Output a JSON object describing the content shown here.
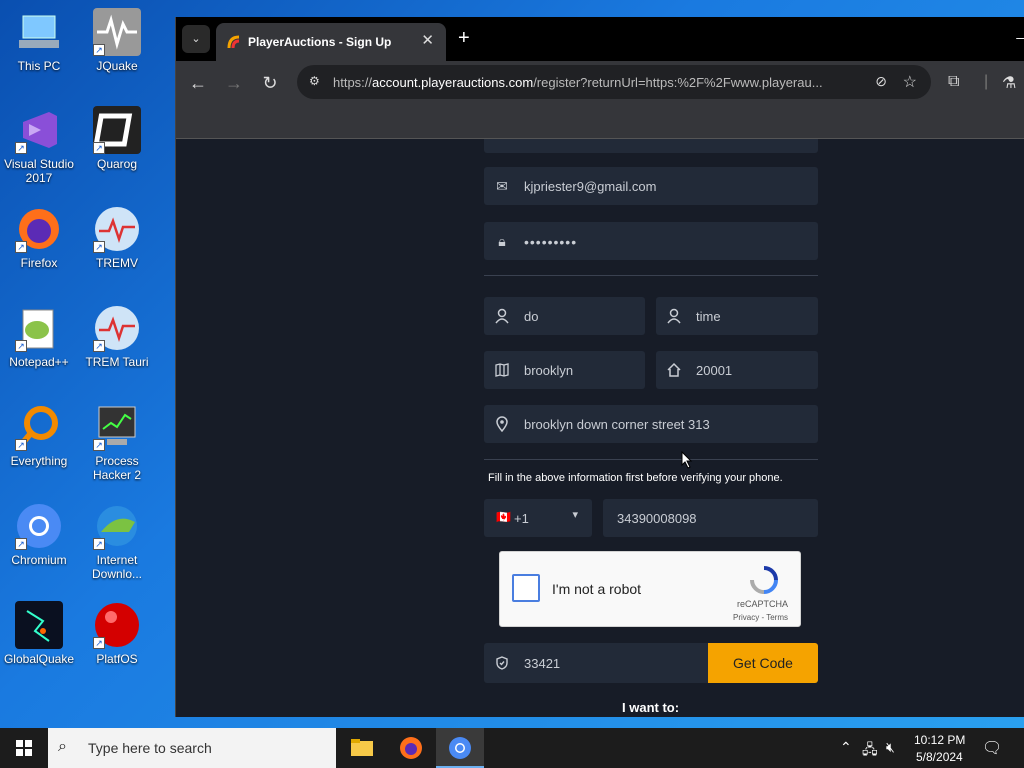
{
  "desktop": {
    "icons": [
      {
        "label": "This PC",
        "icon": "computer-icon"
      },
      {
        "label": "JQuake",
        "icon": "seismograph-icon"
      },
      {
        "label": "Visual Studio 2017",
        "icon": "visual-studio-icon"
      },
      {
        "label": "Quarog",
        "icon": "quarog-icon"
      },
      {
        "label": "Firefox",
        "icon": "firefox-icon"
      },
      {
        "label": "TREMV",
        "icon": "trem-icon"
      },
      {
        "label": "Notepad++",
        "icon": "notepadpp-icon"
      },
      {
        "label": "TREM Tauri",
        "icon": "trem-tauri-icon"
      },
      {
        "label": "Everything",
        "icon": "search-magnifier-icon"
      },
      {
        "label": "Process Hacker 2",
        "icon": "process-hacker-icon"
      },
      {
        "label": "Chromium",
        "icon": "chromium-icon"
      },
      {
        "label": "Internet Downlo...",
        "icon": "idm-icon"
      },
      {
        "label": "GlobalQuake",
        "icon": "globalquake-icon"
      },
      {
        "label": "PlatfOS",
        "icon": "platfos-icon"
      }
    ]
  },
  "browser": {
    "tab_title": "PlayerAuctions - Sign Up",
    "tab_close": "✕",
    "new_tab": "+",
    "url_prefix": "https://",
    "url_domain": "account.playerauctions.com",
    "url_path": "/register?returnUrl=https:%2F%2Fwww.playerau..."
  },
  "form": {
    "email": "kjpriester9@gmail.com",
    "password": "•••••••••",
    "first_name": "do",
    "last_name": "time",
    "city": "brooklyn",
    "zip": "20001",
    "address": "brooklyn down corner street 313",
    "phone_note": "Fill in the above information first before verifying your phone.",
    "country_code": "+1",
    "country_flag": "🇨🇦",
    "phone": "34390008098",
    "captcha_label": "I'm not a robot",
    "captcha_brand": "reCAPTCHA",
    "captcha_links": "Privacy - Terms",
    "verify_code": "33421",
    "get_code_label": "Get Code",
    "want_label": "I want to:"
  },
  "taskbar": {
    "search_placeholder": "Type here to search",
    "time": "10:12 PM",
    "date": "5/8/2024"
  },
  "colors": {
    "accent": "#f5a300",
    "field_bg": "#222a38",
    "page_bg": "#171c27"
  }
}
